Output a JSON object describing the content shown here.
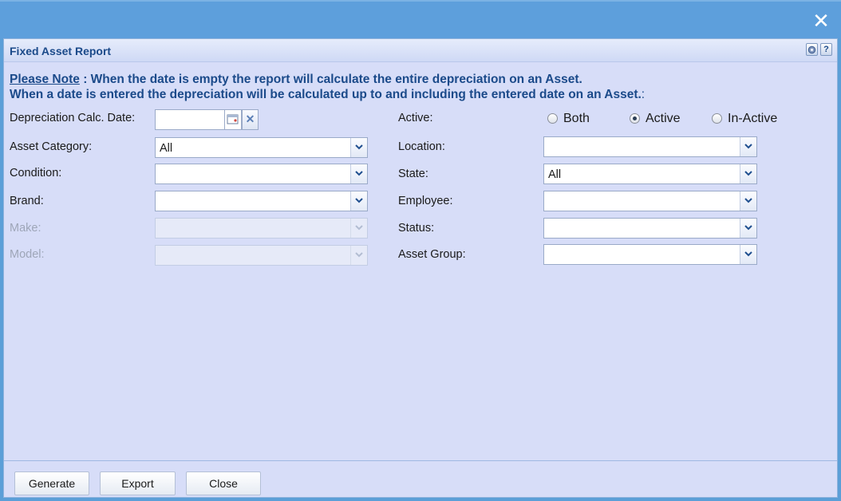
{
  "window": {
    "close_glyph": "✕"
  },
  "panel": {
    "title": "Fixed Asset Report",
    "help_glyph": "?"
  },
  "note": {
    "label": "Please Note",
    "line1": " : When the date is empty the report will calculate the entire depreciation on an Asset.",
    "line2": "When a date is entered the depreciation will be calculated up to and including the entered date on an Asset.",
    "line2_suffix": ":"
  },
  "left_fields": [
    {
      "label": "Depreciation Calc. Date:",
      "value": ""
    },
    {
      "label": "Asset Category:",
      "value": "All"
    },
    {
      "label": "Condition:",
      "value": ""
    },
    {
      "label": "Brand:",
      "value": ""
    },
    {
      "label": "Make:",
      "value": ""
    },
    {
      "label": "Model:",
      "value": ""
    }
  ],
  "right_fields": [
    {
      "label": "Active:"
    },
    {
      "label": "Location:",
      "value": ""
    },
    {
      "label": "State:",
      "value": "All"
    },
    {
      "label": "Employee:",
      "value": ""
    },
    {
      "label": "Status:",
      "value": ""
    },
    {
      "label": "Asset Group:",
      "value": ""
    }
  ],
  "active_options": [
    {
      "label": "Both",
      "selected": false
    },
    {
      "label": "Active",
      "selected": true
    },
    {
      "label": "In-Active",
      "selected": false
    }
  ],
  "buttons": {
    "generate": "Generate",
    "export": "Export",
    "close": "Close"
  },
  "colors": {
    "title_bar": "#5d9fdc",
    "panel_bg": "#d7ddf8",
    "heading_text": "#1b4a8a"
  }
}
